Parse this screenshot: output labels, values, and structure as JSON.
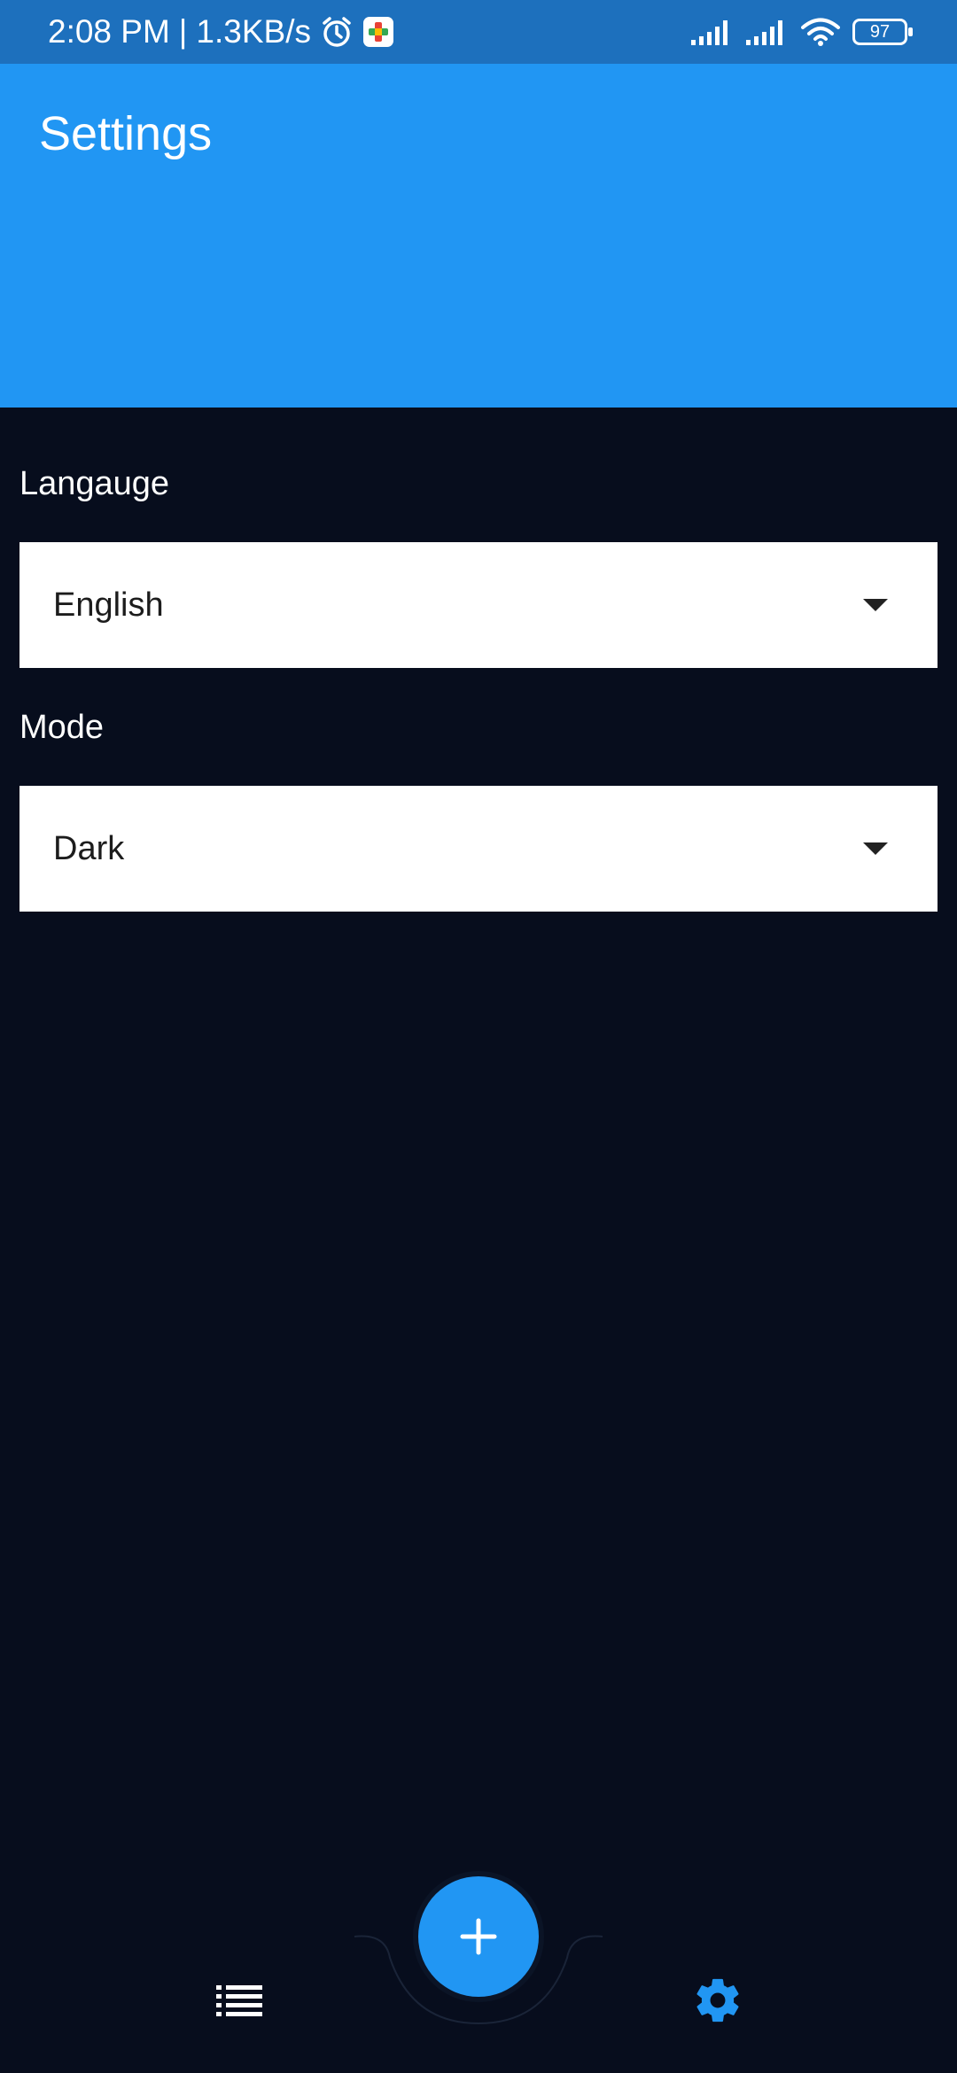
{
  "status_bar": {
    "time": "2:08 PM",
    "separator": "|",
    "network_speed": "1.3KB/s",
    "battery_level": "97",
    "icons": [
      "alarm-icon",
      "app-notification-icon",
      "signal-icon",
      "signal-icon",
      "wifi-icon",
      "battery-icon"
    ]
  },
  "app_bar": {
    "title": "Settings"
  },
  "settings": {
    "language": {
      "label": "Langauge",
      "value": "English"
    },
    "mode": {
      "label": "Mode",
      "value": "Dark"
    }
  },
  "bottom_nav": {
    "items": [
      {
        "icon": "list-icon",
        "active": false
      },
      {
        "icon": "add-icon",
        "role": "fab"
      },
      {
        "icon": "gear-icon",
        "active": true
      }
    ]
  },
  "colors": {
    "status_bar": "#1d70bd",
    "primary": "#2196f3",
    "background": "#070d1d",
    "field_background": "#ffffff",
    "text_on_dark": "#ffffff",
    "text_on_light": "#1c1c1c"
  }
}
